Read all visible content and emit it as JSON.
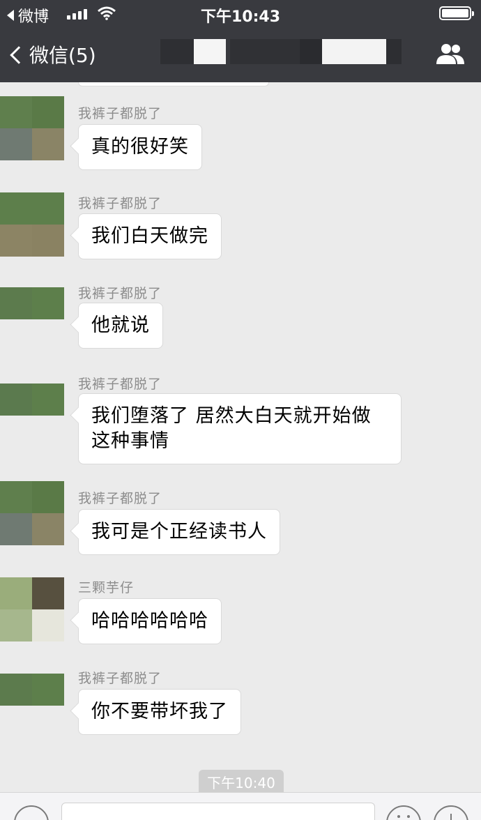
{
  "status_bar": {
    "back_app_label": "微博",
    "time": "下午10:43",
    "signal_icon": "signal-bars-icon",
    "wifi_icon": "wifi-icon",
    "battery_icon": "battery-full-icon"
  },
  "nav": {
    "back_label": "微信(5)",
    "back_icon": "chevron-left-icon",
    "group_icon": "group-people-icon"
  },
  "messages": [
    {
      "sender": "我裤子都脱了",
      "text": "真的很好笑"
    },
    {
      "sender": "我裤子都脱了",
      "text": "我们白天做完"
    },
    {
      "sender": "我裤子都脱了",
      "text": "他就说"
    },
    {
      "sender": "我裤子都脱了",
      "text": "我们堕落了 居然大白天就开始做这种事情"
    },
    {
      "sender": "我裤子都脱了",
      "text": "我可是个正经读书人"
    },
    {
      "sender": "三颗芋仔",
      "text": "哈哈哈哈哈哈"
    },
    {
      "sender": "我裤子都脱了",
      "text": "你不要带坏我了"
    }
  ],
  "timestamp": "下午10:40",
  "colors": {
    "header_bg": "#393a3f",
    "chat_bg": "#ebebeb",
    "bubble_bg": "#ffffff",
    "timestamp_bg": "#cfcfcf"
  }
}
